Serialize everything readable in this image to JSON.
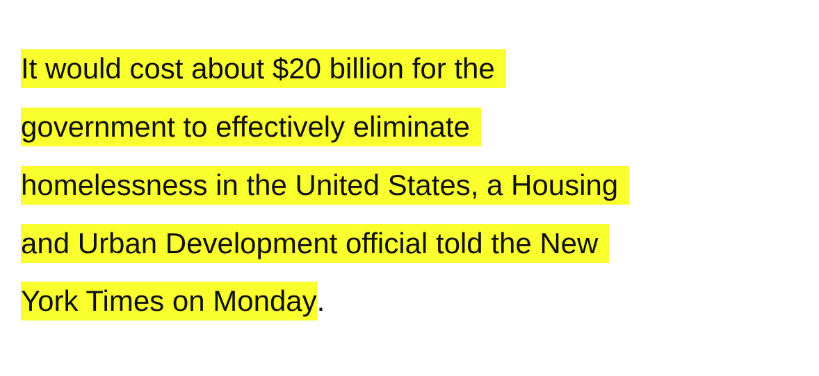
{
  "article": {
    "lines": [
      "It would cost about $20 billion for the",
      "government to effectively eliminate",
      "homelessness in the United States, a Housing",
      "and Urban Development official told the New",
      "York Times on Monday"
    ],
    "trailing_punctuation": "."
  },
  "colors": {
    "highlight": "#faff2e",
    "text": "#111111",
    "background": "#ffffff"
  }
}
